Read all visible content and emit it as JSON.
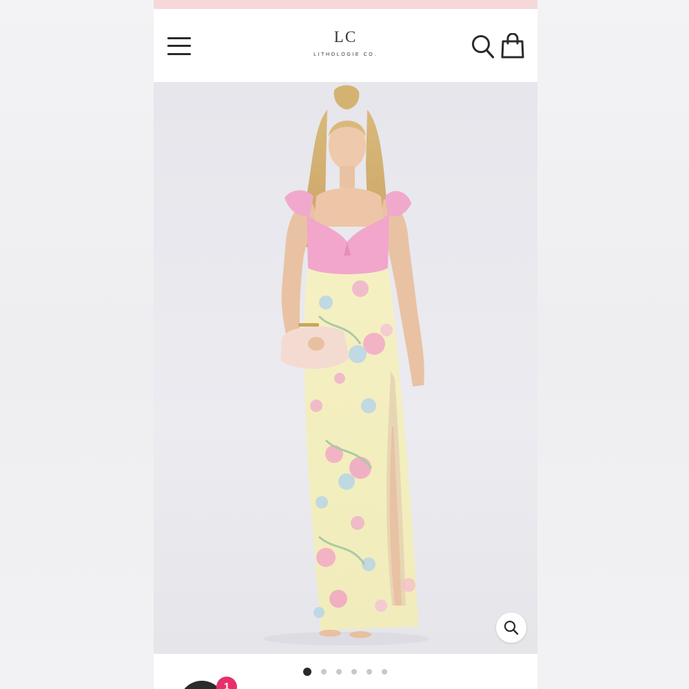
{
  "promo_bar": {
    "color": "#f6d7da"
  },
  "header": {
    "logo_mark": "LC",
    "logo_text": "LITHOLOGIE CO.",
    "menu_icon": "hamburger-menu-icon",
    "search_icon": "search-icon",
    "bag_icon": "shopping-bag-icon"
  },
  "product": {
    "image_description_icon": "product-photo",
    "zoom_icon": "magnifier-zoom-icon"
  },
  "carousel": {
    "total_slides": 6,
    "active_index": 0
  },
  "chat": {
    "badge_count": "1",
    "badge_color": "#e6306a"
  }
}
